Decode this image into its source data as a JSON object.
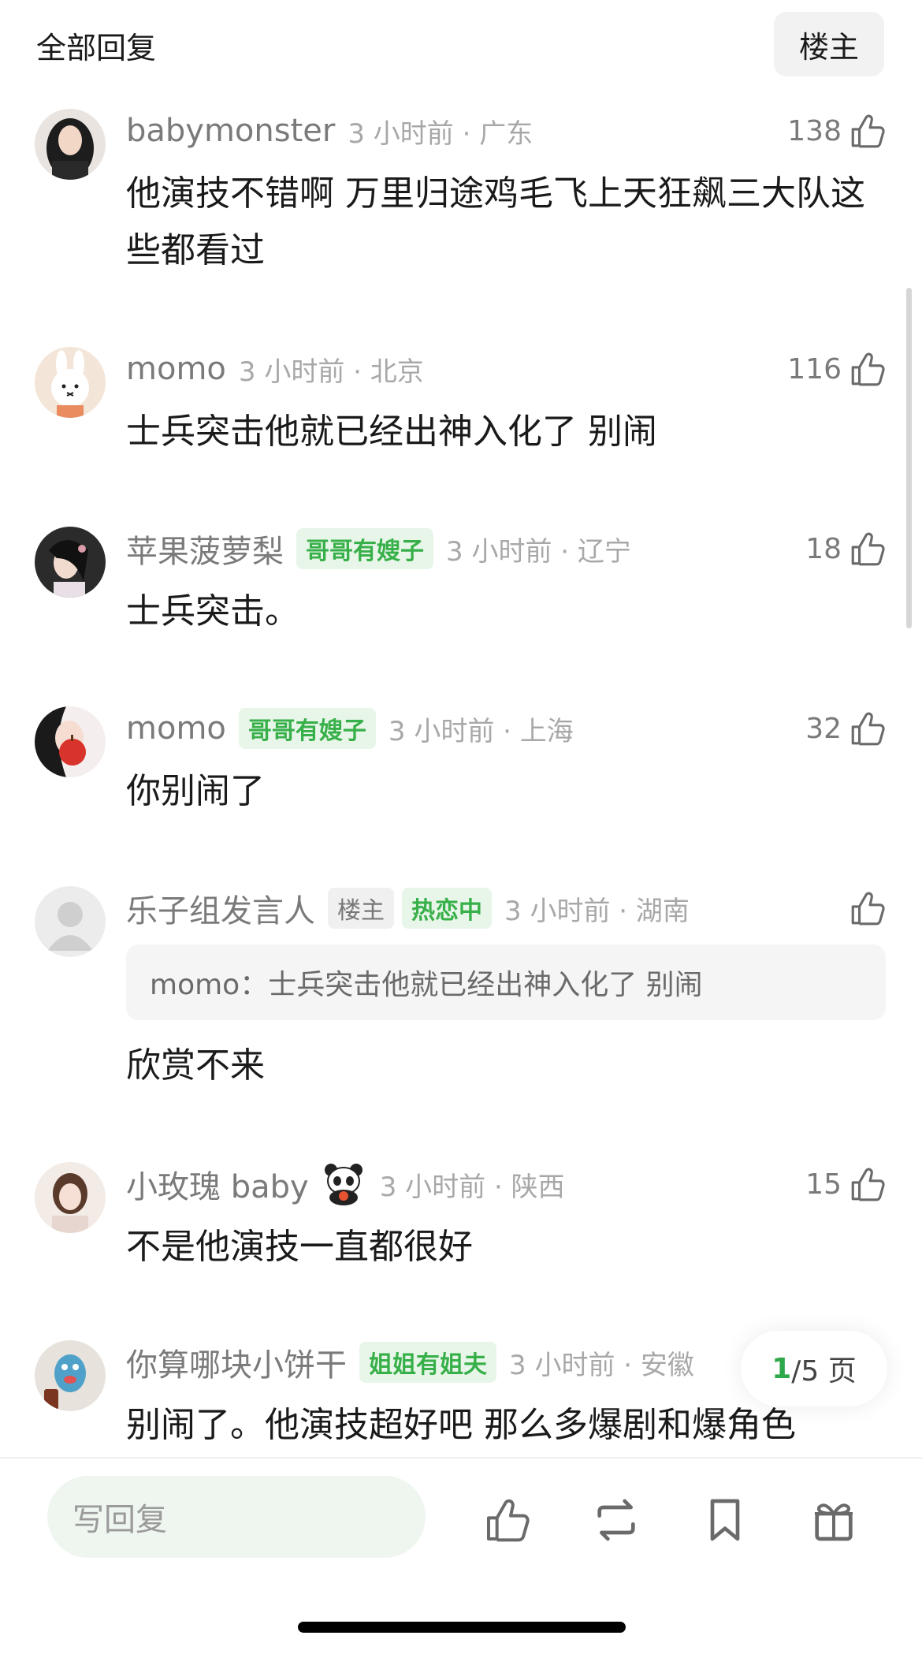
{
  "header": {
    "title": "全部回复",
    "op_filter_label": "楼主"
  },
  "comments": [
    {
      "username": "babymonster",
      "time": "3 小时前",
      "location": "广东",
      "likes": "138",
      "text": "他演技不错啊 万里归途鸡毛飞上天狂飙三大队这些都看过",
      "avatar": "avatar-woman-dark-hair"
    },
    {
      "username": "momo",
      "time": "3 小时前",
      "location": "北京",
      "likes": "116",
      "text": "士兵突击他就已经出神入化了 别闹",
      "avatar": "avatar-bunny-doll"
    },
    {
      "username": "苹果菠萝梨",
      "badge": "哥哥有嫂子",
      "time": "3 小时前",
      "location": "辽宁",
      "likes": "18",
      "text": "士兵突击。",
      "avatar": "avatar-woman-dark-photo"
    },
    {
      "username": "momo",
      "badge": "哥哥有嫂子",
      "time": "3 小时前",
      "location": "上海",
      "likes": "32",
      "text": "你别闹了",
      "avatar": "avatar-woman-red-apple"
    },
    {
      "username": "乐子组发言人",
      "op_badge": "楼主",
      "badge": "热恋中",
      "time": "3 小时前",
      "location": "湖南",
      "likes": "",
      "quote": "momo：士兵突击他就已经出神入化了 别闹",
      "text": "欣赏不来",
      "avatar": "avatar-default-gray"
    },
    {
      "username": "小玫瑰 baby",
      "emoji": "panda-emoji",
      "time": "3 小时前",
      "location": "陕西",
      "likes": "15",
      "text": "不是他演技一直都很好",
      "avatar": "avatar-woman-light-photo"
    },
    {
      "username": "你算哪块小饼干",
      "badge": "姐姐有姐夫",
      "time": "3 小时前",
      "location": "安徽",
      "likes": "",
      "text": "别闹了。他演技超好吧 那么多爆剧和爆角色",
      "avatar": "avatar-blue-toy"
    }
  ],
  "separator": "·",
  "pager": {
    "current": "1",
    "total": "/5 页"
  },
  "bottom": {
    "reply_placeholder": "写回复"
  },
  "icons": [
    "like-icon",
    "repost-icon",
    "bookmark-icon",
    "gift-icon"
  ],
  "colors": {
    "badge_bg": "#e8f6e9",
    "badge_text": "#38b04a",
    "pager_current": "#2da84a"
  }
}
